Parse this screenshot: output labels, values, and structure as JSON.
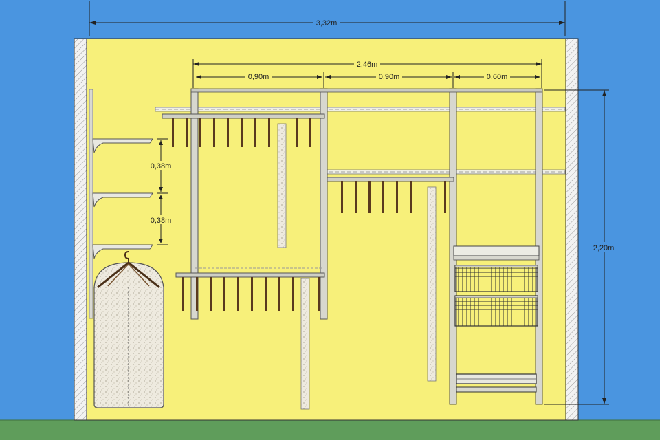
{
  "caption": "",
  "colors": {
    "sky": "#4a95e0",
    "wall": "#f7f07a",
    "floor": "#5f9d5b",
    "metal": "#b8b8b0",
    "hanger": "#6a4a2a",
    "dim_line": "#222222"
  },
  "dimensions": {
    "total_width": "3,32m",
    "system_width": "2,46m",
    "section_1": "0,90m",
    "section_2": "0,90m",
    "section_3": "0,60m",
    "height": "2,20m",
    "shelf_gap_1": "0,38m",
    "shelf_gap_2": "0,38m"
  },
  "components": [
    "side-wall-left",
    "side-wall-right",
    "wall-shelves",
    "garment-bag",
    "section-left",
    "section-middle",
    "section-right",
    "wire-baskets",
    "shoe-rack"
  ]
}
